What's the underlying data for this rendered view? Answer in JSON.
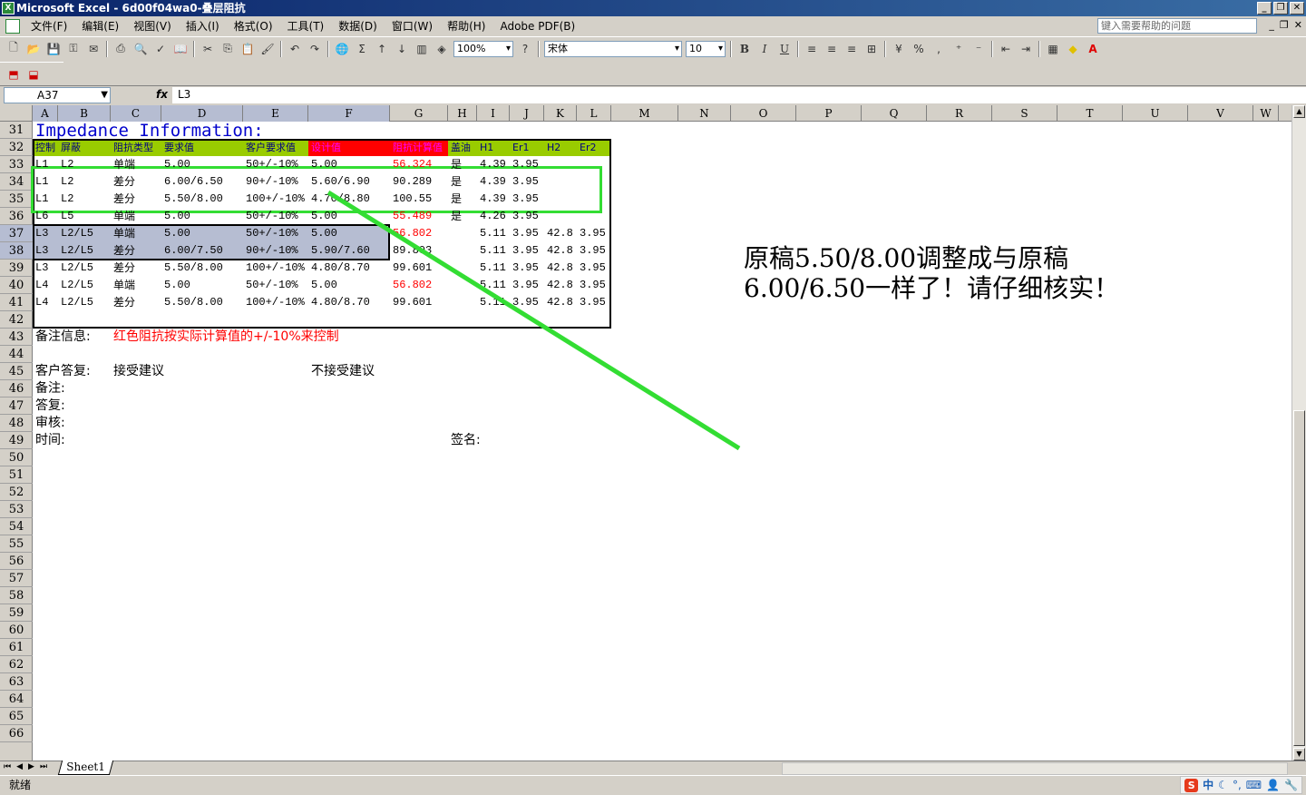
{
  "window": {
    "title": "Microsoft Excel - 6d00f04wa0-叠层阻抗"
  },
  "menu": {
    "items": [
      "文件(F)",
      "编辑(E)",
      "视图(V)",
      "插入(I)",
      "格式(O)",
      "工具(T)",
      "数据(D)",
      "窗口(W)",
      "帮助(H)",
      "Adobe PDF(B)"
    ],
    "help_placeholder": "键入需要帮助的问题"
  },
  "toolbar": {
    "zoom": "100%",
    "font": "宋体",
    "font_size": "10"
  },
  "formula_bar": {
    "name_box": "A37",
    "fx": "fx",
    "content": "L3"
  },
  "columns": [
    "A",
    "B",
    "C",
    "D",
    "E",
    "F",
    "G",
    "H",
    "I",
    "J",
    "K",
    "L",
    "M",
    "N",
    "O",
    "P",
    "Q",
    "R",
    "S",
    "T",
    "U",
    "V",
    "W"
  ],
  "rows": [
    "31",
    "32",
    "33",
    "34",
    "35",
    "36",
    "37",
    "38",
    "39",
    "40",
    "41",
    "42",
    "43",
    "44",
    "45",
    "46",
    "47",
    "48",
    "49",
    "50",
    "51",
    "52",
    "53",
    "54",
    "55",
    "56",
    "57",
    "58",
    "59",
    "60",
    "61",
    "62",
    "63",
    "64",
    "65",
    "66"
  ],
  "sheet": {
    "title": "Impedance Information:",
    "header": [
      "控制",
      "屏蔽",
      "阻抗类型",
      "要求值",
      "客户要求值",
      "设计值",
      "阻抗计算值",
      "盖油",
      "H1",
      "Er1",
      "H2",
      "Er2"
    ],
    "data_rows": [
      [
        "L1",
        "L2",
        "单端",
        "5.00",
        "50+/-10%",
        "5.00",
        "56.324",
        "是",
        "4.39",
        "3.95",
        "",
        ""
      ],
      [
        "L1",
        "L2",
        "差分",
        "6.00/6.50",
        "90+/-10%",
        "5.60/6.90",
        "90.289",
        "是",
        "4.39",
        "3.95",
        "",
        ""
      ],
      [
        "L1",
        "L2",
        "差分",
        "5.50/8.00",
        "100+/-10%",
        "4.70/8.80",
        "100.55",
        "是",
        "4.39",
        "3.95",
        "",
        ""
      ],
      [
        "L6",
        "L5",
        "单端",
        "5.00",
        "50+/-10%",
        "5.00",
        "55.489",
        "是",
        "4.26",
        "3.95",
        "",
        ""
      ],
      [
        "L3",
        "L2/L5",
        "单端",
        "5.00",
        "50+/-10%",
        "5.00",
        "56.802",
        "",
        "5.11",
        "3.95",
        "42.8",
        "3.95"
      ],
      [
        "L3",
        "L2/L5",
        "差分",
        "6.00/7.50",
        "90+/-10%",
        "5.90/7.60",
        "89.803",
        "",
        "5.11",
        "3.95",
        "42.8",
        "3.95"
      ],
      [
        "L3",
        "L2/L5",
        "差分",
        "5.50/8.00",
        "100+/-10%",
        "4.80/8.70",
        "99.601",
        "",
        "5.11",
        "3.95",
        "42.8",
        "3.95"
      ],
      [
        "L4",
        "L2/L5",
        "单端",
        "5.00",
        "50+/-10%",
        "5.00",
        "56.802",
        "",
        "5.11",
        "3.95",
        "42.8",
        "3.95"
      ],
      [
        "L4",
        "L2/L5",
        "差分",
        "5.50/8.00",
        "100+/-10%",
        "4.80/8.70",
        "99.601",
        "",
        "5.11",
        "3.95",
        "42.8",
        "3.95"
      ]
    ],
    "red_g_rows": [
      0,
      3,
      4,
      7
    ],
    "note_label": "备注信息:",
    "note_text": "红色阻抗按实际计算值的+/-10%来控制",
    "reply_label": "客户答复:",
    "accept": "接受建议",
    "reject": "不接受建议",
    "remark_label": "备注:",
    "answer_label": "答复:",
    "review_label": "审核:",
    "time_label": "时间:",
    "sign_label": "签名:"
  },
  "annotation": {
    "text": "原稿5.50/8.00调整成与原稿6.00/6.50一样了！请仔细核实！",
    "color": "#33dd33"
  },
  "tabs": {
    "sheet1": "Sheet1"
  },
  "status": {
    "ready": "就绪"
  },
  "ime": {
    "logo": "S",
    "lang": "中"
  }
}
